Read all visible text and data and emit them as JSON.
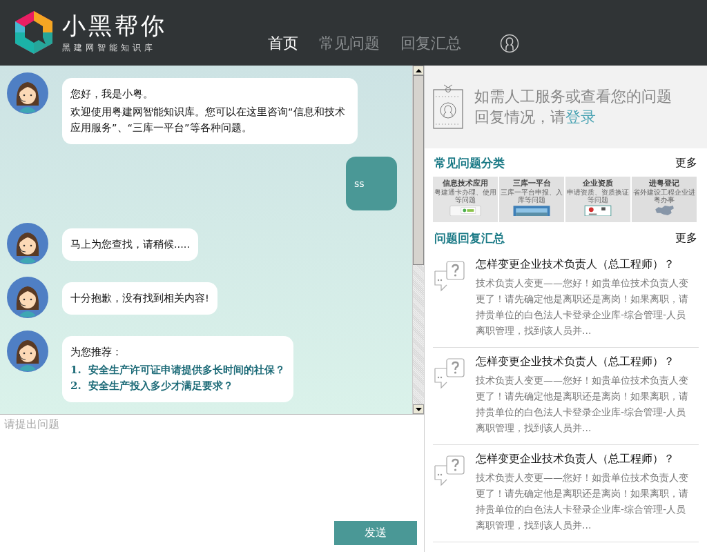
{
  "header": {
    "logo_title": "小黑帮你",
    "logo_subtitle": "黑建网智能知识库",
    "nav": [
      {
        "label": "首页",
        "selected": true
      },
      {
        "label": "常见问题",
        "selected": false
      },
      {
        "label": "回复汇总",
        "selected": false
      }
    ]
  },
  "chat": {
    "messages": [
      {
        "kind": "bot",
        "paragraphs": [
          "您好，我是小粤。",
          "欢迎使用粤建网智能知识库。您可以在这里咨询“信息和技术应用服务”、“三库一平台”等各种问题。"
        ]
      },
      {
        "kind": "user",
        "paragraphs": [
          "ss"
        ]
      },
      {
        "kind": "bot",
        "paragraphs": [
          "马上为您查找，请稍候....."
        ]
      },
      {
        "kind": "bot",
        "paragraphs": [
          "十分抱歉，没有找到相关内容!"
        ]
      },
      {
        "kind": "bot",
        "paragraphs": [
          "为您推荐："
        ],
        "links": [
          {
            "number": "1.",
            "text": "安全生产许可证申请提供多长时间的社保？"
          },
          {
            "number": "2.",
            "text": "安全生产投入多少才满足要求？"
          }
        ]
      }
    ],
    "input": {
      "placeholder": "请提出问题"
    },
    "send_button": "发送"
  },
  "login_box": {
    "text": "如需人工服务或查看您的问题回复情况，请",
    "link": "登录"
  },
  "categories": {
    "title": "常见问题分类",
    "more": "更多",
    "tiles": [
      {
        "kind": "card",
        "title": "信息技术应用",
        "subtitle": "粤建通卡办理、使用等问题"
      },
      {
        "kind": "screen",
        "title": "三库一平台",
        "subtitle": "三库一平台申报、入库等问题"
      },
      {
        "kind": "certificate",
        "title": "企业资质",
        "subtitle": "申请资质、资质换证等问题"
      },
      {
        "kind": "map",
        "title": "进粤登记",
        "subtitle": "省外建设工程企业进粤办事"
      }
    ]
  },
  "answers": {
    "title": "问题回复汇总",
    "more": "更多",
    "items": [
      {
        "question": "怎样变更企业技术负责人（总工程师）？",
        "summary": "技术负责人变更——您好！如贵单位技术负责人变更了！请先确定他是离职还是离岗！如果离职，请持贵单位的白色法人卡登录企业库-综合管理-人员离职管理，找到该人员并..."
      },
      {
        "question": "怎样变更企业技术负责人（总工程师）？",
        "summary": "技术负责人变更——您好！如贵单位技术负责人变更了！请先确定他是离职还是离岗！如果离职，请持贵单位的白色法人卡登录企业库-综合管理-人员离职管理，找到该人员并..."
      },
      {
        "question": "怎样变更企业技术负责人（总工程师）？",
        "summary": "技术负责人变更——您好！如贵单位技术负责人变更了！请先确定他是离职还是离岗！如果离职，请持贵单位的白色法人卡登录企业库-综合管理-人员离职管理，找到该人员并..."
      }
    ]
  }
}
